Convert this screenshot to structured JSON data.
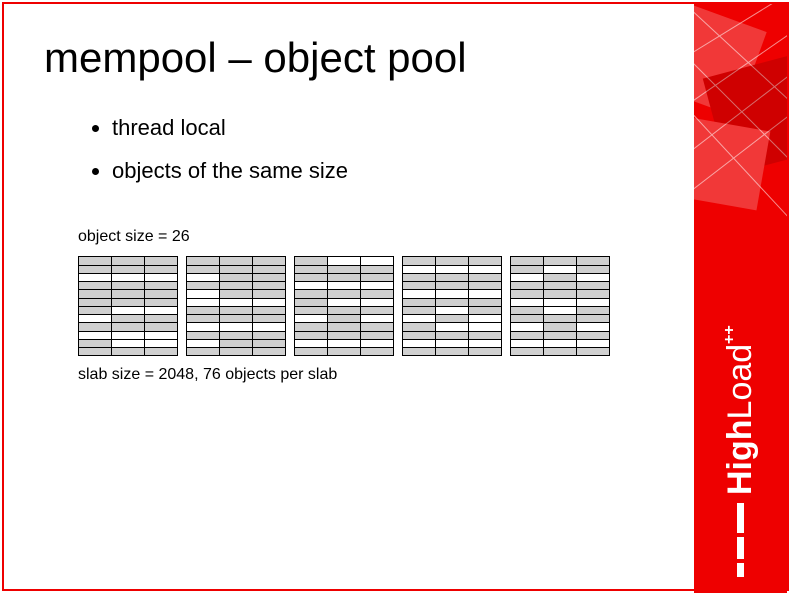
{
  "title": "mempool – object pool",
  "bullets": [
    "thread local",
    "objects of the same size"
  ],
  "diagram": {
    "object_size_label": "object size = 26",
    "slab_size_label": "slab size = 2048, 76 objects per slab",
    "slab_count": 5,
    "slab_rows": 12,
    "slab_cols": 3,
    "slabs": [
      [
        [
          1,
          1,
          1
        ],
        [
          1,
          1,
          1
        ],
        [
          0,
          0,
          0
        ],
        [
          1,
          1,
          1
        ],
        [
          1,
          1,
          1
        ],
        [
          1,
          1,
          1
        ],
        [
          1,
          0,
          0
        ],
        [
          0,
          1,
          1
        ],
        [
          1,
          1,
          1
        ],
        [
          0,
          0,
          0
        ],
        [
          1,
          0,
          0
        ],
        [
          1,
          1,
          1
        ]
      ],
      [
        [
          1,
          1,
          1
        ],
        [
          1,
          1,
          1
        ],
        [
          0,
          1,
          1
        ],
        [
          1,
          1,
          1
        ],
        [
          0,
          1,
          1
        ],
        [
          0,
          0,
          0
        ],
        [
          1,
          1,
          1
        ],
        [
          1,
          1,
          1
        ],
        [
          0,
          0,
          0
        ],
        [
          1,
          1,
          1
        ],
        [
          0,
          1,
          1
        ],
        [
          1,
          1,
          1
        ]
      ],
      [
        [
          1,
          0,
          0
        ],
        [
          1,
          1,
          1
        ],
        [
          1,
          1,
          1
        ],
        [
          0,
          0,
          0
        ],
        [
          1,
          1,
          1
        ],
        [
          1,
          0,
          0
        ],
        [
          1,
          1,
          1
        ],
        [
          0,
          1,
          0
        ],
        [
          1,
          1,
          1
        ],
        [
          1,
          1,
          1
        ],
        [
          0,
          0,
          0
        ],
        [
          1,
          1,
          1
        ]
      ],
      [
        [
          1,
          1,
          1
        ],
        [
          0,
          0,
          0
        ],
        [
          1,
          1,
          1
        ],
        [
          1,
          1,
          1
        ],
        [
          0,
          0,
          0
        ],
        [
          1,
          1,
          1
        ],
        [
          1,
          0,
          1
        ],
        [
          0,
          1,
          0
        ],
        [
          1,
          0,
          0
        ],
        [
          1,
          1,
          1
        ],
        [
          0,
          0,
          0
        ],
        [
          1,
          1,
          1
        ]
      ],
      [
        [
          1,
          1,
          1
        ],
        [
          1,
          0,
          1
        ],
        [
          0,
          1,
          0
        ],
        [
          1,
          1,
          1
        ],
        [
          1,
          1,
          1
        ],
        [
          0,
          0,
          0
        ],
        [
          1,
          0,
          1
        ],
        [
          1,
          1,
          1
        ],
        [
          0,
          1,
          0
        ],
        [
          1,
          1,
          1
        ],
        [
          0,
          0,
          0
        ],
        [
          1,
          1,
          1
        ]
      ]
    ]
  },
  "brand": {
    "name_bold": "High",
    "name_light": "Load",
    "suffix": "++"
  }
}
